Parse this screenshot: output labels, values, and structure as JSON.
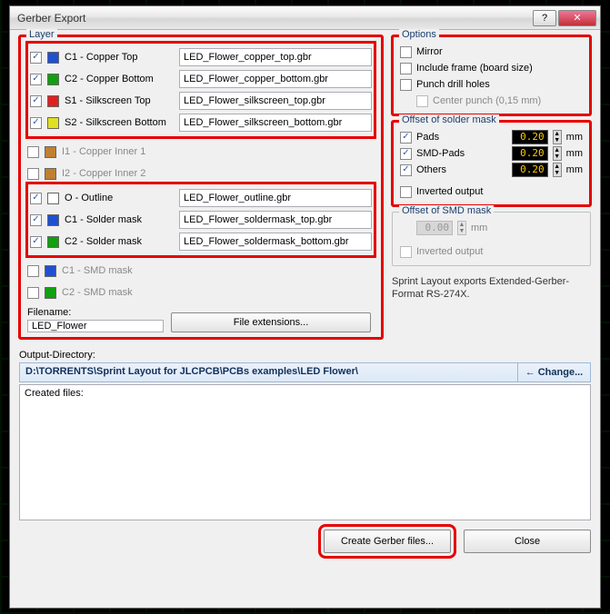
{
  "window": {
    "title": "Gerber Export"
  },
  "layer_group": {
    "legend": "Layer"
  },
  "layers": [
    {
      "checked": true,
      "color": "#2050d0",
      "name": "C1 - Copper Top",
      "file": "LED_Flower_copper_top.gbr"
    },
    {
      "checked": true,
      "color": "#10a010",
      "name": "C2 - Copper Bottom",
      "file": "LED_Flower_copper_bottom.gbr"
    },
    {
      "checked": true,
      "color": "#e02020",
      "name": "S1 - Silkscreen Top",
      "file": "LED_Flower_silkscreen_top.gbr"
    },
    {
      "checked": true,
      "color": "#e0e020",
      "name": "S2 - Silkscreen Bottom",
      "file": "LED_Flower_silkscreen_bottom.gbr"
    }
  ],
  "inner_layers": [
    {
      "checked": false,
      "color": "#c08030",
      "name": "I1 - Copper Inner 1"
    },
    {
      "checked": false,
      "color": "#c08030",
      "name": "I2 - Copper Inner 2"
    }
  ],
  "mask_layers": [
    {
      "checked": true,
      "color": "#ffffff",
      "name": "O - Outline",
      "file": "LED_Flower_outline.gbr"
    },
    {
      "checked": true,
      "color": "#2050d0",
      "name": "C1 - Solder mask",
      "file": "LED_Flower_soldermask_top.gbr"
    },
    {
      "checked": true,
      "color": "#10a010",
      "name": "C2 - Solder mask",
      "file": "LED_Flower_soldermask_bottom.gbr"
    }
  ],
  "smd_layers": [
    {
      "checked": false,
      "color": "#2050d0",
      "name": "C1 - SMD mask"
    },
    {
      "checked": false,
      "color": "#10a010",
      "name": "C2 - SMD mask"
    }
  ],
  "filename": {
    "label": "Filename:",
    "value": "LED_Flower",
    "ext_button": "File extensions..."
  },
  "options": {
    "legend": "Options",
    "mirror": "Mirror",
    "include_frame": "Include frame (board size)",
    "punch": "Punch drill holes",
    "center_punch": "Center punch (0,15 mm)"
  },
  "solder_offset": {
    "legend": "Offset of solder mask",
    "pads": {
      "label": "Pads",
      "value": "0.20",
      "unit": "mm",
      "checked": true
    },
    "smd": {
      "label": "SMD-Pads",
      "value": "0.20",
      "unit": "mm",
      "checked": true
    },
    "others": {
      "label": "Others",
      "value": "0.20",
      "unit": "mm",
      "checked": true
    },
    "inverted": "Inverted output"
  },
  "smd_offset": {
    "legend": "Offset of SMD mask",
    "value": "0.00",
    "unit": "mm",
    "inverted": "Inverted output"
  },
  "export_note": "Sprint Layout exports Extended-Gerber-Format RS-274X.",
  "output": {
    "label": "Output-Directory:",
    "path": "D:\\TORRENTS\\Sprint Layout for JLCPCB\\PCBs examples\\LED Flower\\",
    "change": "Change...",
    "created_label": "Created files:"
  },
  "buttons": {
    "create": "Create Gerber files...",
    "close": "Close"
  }
}
